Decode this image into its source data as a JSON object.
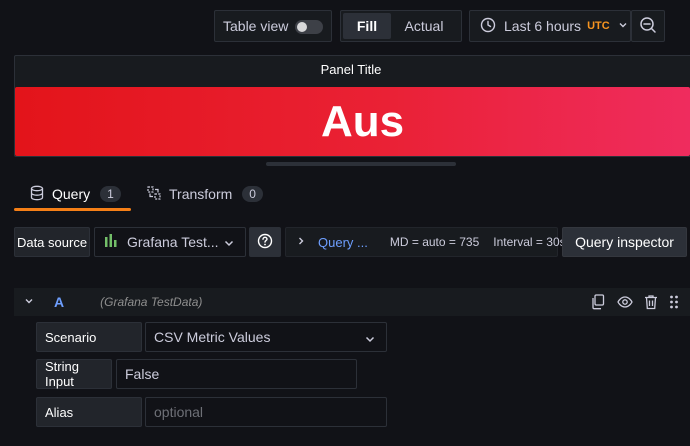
{
  "toolbar": {
    "table_view_label": "Table view",
    "fill_label": "Fill",
    "actual_label": "Actual",
    "time_range_label": "Last 6 hours",
    "timezone_label": "UTC"
  },
  "panel": {
    "title": "Panel Title",
    "stat_value": "Aus",
    "stat_color_start": "#e3141a",
    "stat_color_end": "#ef2c5e"
  },
  "tabs": [
    {
      "label": "Query",
      "count": "1",
      "active": true
    },
    {
      "label": "Transform",
      "count": "0",
      "active": false
    }
  ],
  "query_options": {
    "data_source_label": "Data source",
    "data_source_value": "Grafana Test...",
    "options_label": "Query ...",
    "md_text": "MD = auto = 735",
    "interval_text": "Interval = 30s",
    "inspector_label": "Query inspector"
  },
  "query_row": {
    "ref_id": "A",
    "data_source_name": "(Grafana TestData)",
    "fields": [
      {
        "label": "Scenario",
        "value": "CSV Metric Values",
        "placeholder": ""
      },
      {
        "label": "String Input",
        "value": "False",
        "placeholder": ""
      },
      {
        "label": "Alias",
        "value": "",
        "placeholder": "optional"
      }
    ]
  },
  "colors": {
    "accent_orange": "#f57f17",
    "link_blue": "#6e9fff",
    "utc_orange": "#f79520"
  }
}
